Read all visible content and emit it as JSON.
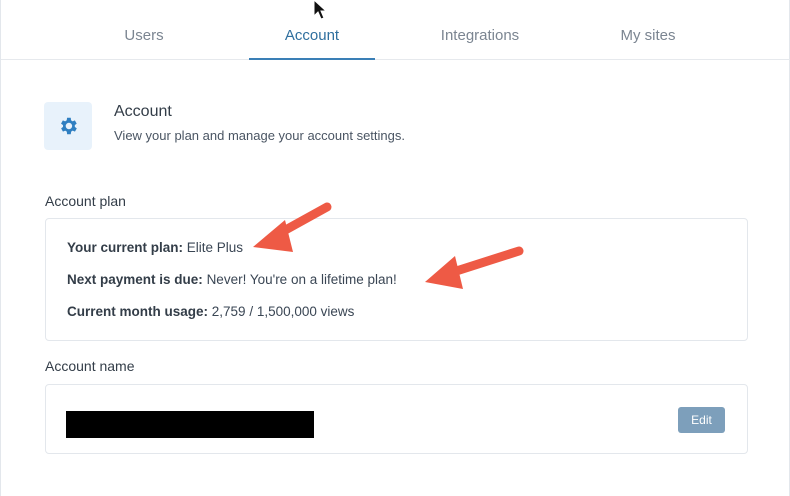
{
  "tabs": [
    {
      "label": "Users",
      "active": false
    },
    {
      "label": "Account",
      "active": true
    },
    {
      "label": "Integrations",
      "active": false
    },
    {
      "label": "My sites",
      "active": false
    }
  ],
  "header": {
    "icon": "gear-icon",
    "title": "Account",
    "subtitle": "View your plan and manage your account settings."
  },
  "account_plan": {
    "section_label": "Account plan",
    "current_plan_label": "Your current plan:",
    "current_plan_value": "Elite Plus",
    "next_payment_label": "Next payment is due:",
    "next_payment_value": "Never! You're on a lifetime plan!",
    "usage_label": "Current month usage:",
    "usage_value": "2,759 / 1,500,000 views"
  },
  "account_name": {
    "section_label": "Account name",
    "edit_label": "Edit"
  },
  "colors": {
    "accent": "#3a7fb6",
    "annotation_arrow": "#ee5a45",
    "edit_button": "#7d9fbb"
  }
}
